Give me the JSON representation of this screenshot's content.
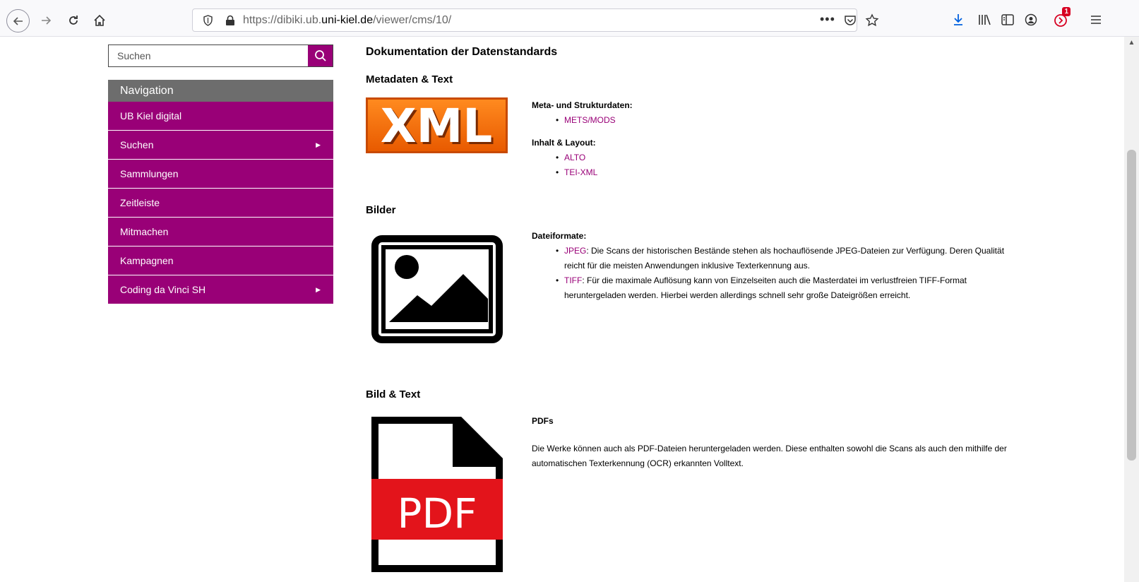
{
  "browser": {
    "url_prefix": "https://dibiki.ub.",
    "url_domain": "uni-kiel.de",
    "url_suffix": "/viewer/cms/10/",
    "url_dots": "•••",
    "notification_count": "1"
  },
  "sidebar": {
    "search_placeholder": "Suchen",
    "nav_title": "Navigation",
    "items": [
      {
        "label": "UB Kiel digital"
      },
      {
        "label": "Suchen",
        "caret": "▶"
      },
      {
        "label": "Sammlungen"
      },
      {
        "label": "Zeitleiste"
      },
      {
        "label": "Mitmachen"
      },
      {
        "label": "Kampagnen"
      },
      {
        "label": "Coding da Vinci SH",
        "caret": "▶"
      }
    ]
  },
  "main": {
    "title": "Dokumentation der Datenstandards",
    "metadata": {
      "heading": "Metadaten & Text",
      "logo_text": "XML",
      "label1": "Meta- und Strukturdaten:",
      "links1": [
        "METS/MODS"
      ],
      "label2": "Inhalt & Layout:",
      "links2": [
        "ALTO",
        "TEI-XML"
      ]
    },
    "images": {
      "heading": "Bilder",
      "label": "Dateiformate:",
      "jpeg_link": "JPEG",
      "jpeg_text": ": Die Scans der historischen Bestände stehen als hochauflösende JPEG-Dateien zur Verfügung. Deren Qualität reicht für die meisten Anwendungen inklusive Texterkennung aus.",
      "tiff_link": "TIFF",
      "tiff_text": ": Für die maximale Auflösung kann von Einzelseiten auch die Masterdatei im verlustfreien TIFF-Format heruntergeladen werden. Hierbei werden allerdings schnell sehr große Dateigrößen erreicht."
    },
    "image_text": {
      "heading": "Bild & Text",
      "label": "PDFs",
      "pdf_badge": "PDF",
      "text": "Die Werke können auch als PDF-Dateien heruntergeladen werden. Diese enthalten sowohl die Scans als auch den mithilfe der automatischen Texterkennung (OCR) erkannten Volltext."
    }
  },
  "colors": {
    "accent": "#990077",
    "nav_header": "#6d6d6d",
    "xml_orange": "#f26b00",
    "pdf_red": "#e3141b"
  }
}
